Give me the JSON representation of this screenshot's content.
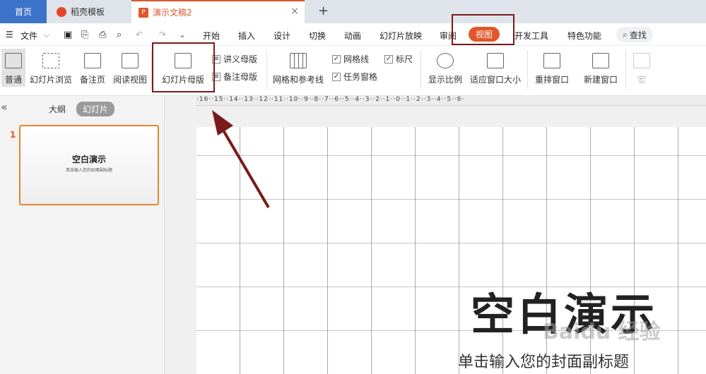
{
  "tabs": {
    "home": "首页",
    "template": "稻壳模板",
    "document": "演示文稿2",
    "add": "+",
    "close": "×"
  },
  "menu": {
    "file": "文件",
    "items": [
      "开始",
      "插入",
      "设计",
      "切换",
      "动画",
      "幻灯片放映",
      "审阅",
      "视图",
      "开发工具",
      "特色功能"
    ],
    "search": "查找"
  },
  "ribbon": {
    "normal": "普通",
    "slide_browse": "幻灯片浏览",
    "notes_page": "备注页",
    "reading_view": "阅读视图",
    "slide_master": "幻灯片母版",
    "handout_master": "讲义母版",
    "notes_master": "备注母版",
    "grid_guides": "网格和参考线",
    "gridlines": "网格线",
    "ruler": "标尺",
    "task_pane": "任务窗格",
    "zoom": "显示比例",
    "fit_window": "适应窗口大小",
    "rearrange": "重排窗口",
    "new_window": "新建窗口",
    "macro": "宏"
  },
  "panel": {
    "collapse": "«",
    "outline_tab": "大纲",
    "slides_tab": "幻灯片",
    "slide_number": "1",
    "thumb_title": "空白演示",
    "thumb_sub": "单击输入您的封面副标题"
  },
  "ruler_text": "·16··15··14··13··12··11··10··9··8··7··6··5··4··3··2··1··0··1··2··3··4··5··6·",
  "slide": {
    "title": "空白演示",
    "subtitle": "单击输入您的封面副标题",
    "watermark": "Baidu 经验"
  },
  "colors": {
    "accent": "#e2562b",
    "highlight": "#7a1a1a",
    "home_tab": "#3d73c9"
  }
}
